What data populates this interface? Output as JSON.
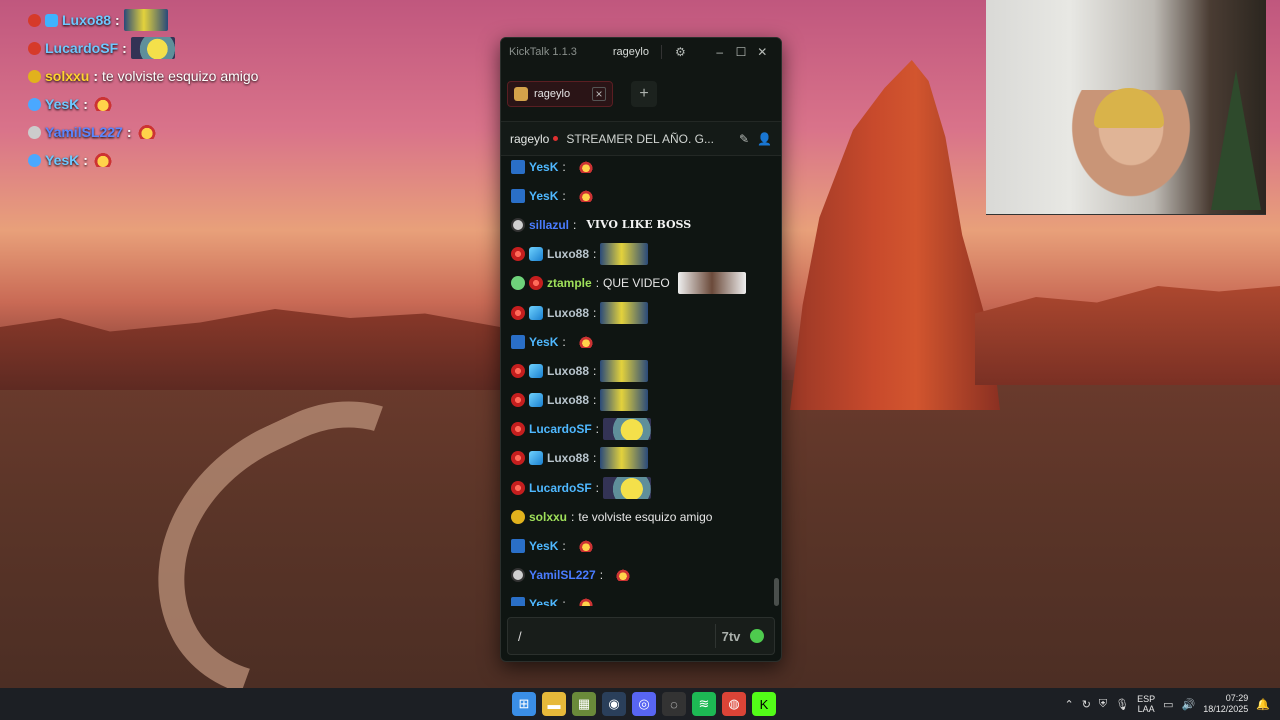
{
  "overlay_chat": [
    {
      "user": "Luxo88",
      "badge": "red",
      "badge2": "cube",
      "color": "cyan",
      "text": "",
      "emote": "wide"
    },
    {
      "user": "LucardoSF",
      "badge": "red",
      "color": "cyan",
      "text": "",
      "emote": "ball"
    },
    {
      "user": "solxxu",
      "badge": "gold",
      "color": "yellow",
      "text": "te volviste esquizo amigo",
      "emote": ""
    },
    {
      "user": "YesK",
      "badge": "pick",
      "color": "cyan",
      "text": "",
      "emote": "small"
    },
    {
      "user": "YamilSL227",
      "badge": "skull",
      "color": "blue",
      "text": "",
      "emote": "small"
    },
    {
      "user": "YesK",
      "badge": "pick",
      "color": "cyan",
      "text": "",
      "emote": "small"
    }
  ],
  "window": {
    "app_title": "KickTalk 1.1.3",
    "titlebar_user": "rageylo",
    "settings_icon": "gear-icon",
    "minimize_icon": "minimize-icon",
    "maximize_icon": "maximize-icon",
    "close_icon": "close-icon"
  },
  "tabs": [
    {
      "label": "rageylo",
      "active": true
    }
  ],
  "add_tab_label": "+",
  "channel": {
    "name": "rageylo",
    "stream_title": "STREAMER DEL AÑO. G...",
    "pin_icon": "pin-icon",
    "user_icon": "user-icon"
  },
  "chat_messages": [
    {
      "user": "YesK",
      "badges": [
        "pick"
      ],
      "color": "cyan",
      "text": "",
      "emote": "small"
    },
    {
      "user": "YesK",
      "badges": [
        "pick"
      ],
      "color": "cyan",
      "text": "",
      "emote": "small"
    },
    {
      "user": "sillazul",
      "badges": [
        "skull"
      ],
      "color": "blue",
      "text": "",
      "emote": "vivo",
      "emote_text": "VIVO LIKE BOSS"
    },
    {
      "user": "Luxo88",
      "badges": [
        "red",
        "cube"
      ],
      "color": "gray",
      "text": "",
      "emote": "wide"
    },
    {
      "user": "ztample",
      "badges": [
        "alien",
        "red"
      ],
      "color": "green",
      "text": "QUE VIDEO",
      "emote": "face"
    },
    {
      "user": "Luxo88",
      "badges": [
        "red",
        "cube"
      ],
      "color": "gray",
      "text": "",
      "emote": "wide"
    },
    {
      "user": "YesK",
      "badges": [
        "pick"
      ],
      "color": "cyan",
      "text": "",
      "emote": "small"
    },
    {
      "user": "Luxo88",
      "badges": [
        "red",
        "cube"
      ],
      "color": "gray",
      "text": "",
      "emote": "wide"
    },
    {
      "user": "Luxo88",
      "badges": [
        "red",
        "cube"
      ],
      "color": "gray",
      "text": "",
      "emote": "wide"
    },
    {
      "user": "LucardoSF",
      "badges": [
        "red"
      ],
      "color": "cyan",
      "text": "",
      "emote": "ball"
    },
    {
      "user": "Luxo88",
      "badges": [
        "red",
        "cube"
      ],
      "color": "gray",
      "text": "",
      "emote": "wide"
    },
    {
      "user": "LucardoSF",
      "badges": [
        "red"
      ],
      "color": "cyan",
      "text": "",
      "emote": "ball"
    },
    {
      "user": "solxxu",
      "badges": [
        "gold"
      ],
      "color": "green",
      "text": "te volviste esquizo amigo",
      "emote": ""
    },
    {
      "user": "YesK",
      "badges": [
        "pick"
      ],
      "color": "cyan",
      "text": "",
      "emote": "small"
    },
    {
      "user": "YamilSL227",
      "badges": [
        "skull"
      ],
      "color": "blue",
      "text": "",
      "emote": "small"
    },
    {
      "user": "YesK",
      "badges": [
        "pick"
      ],
      "color": "cyan",
      "text": "",
      "emote": "small"
    }
  ],
  "input": {
    "value": "/",
    "placeholder": "",
    "emote_button": "7tv",
    "emoji_icon": "emoji-icon"
  },
  "taskbar": {
    "apps": [
      "windows-start-icon",
      "file-explorer-icon",
      "app-icon",
      "steam-icon",
      "discord-icon",
      "obs-icon",
      "spotify-icon",
      "chrome-icon",
      "kick-icon"
    ],
    "lang_line1": "ESP",
    "lang_line2": "LAA",
    "time": "07:29",
    "date": "18/12/2025"
  },
  "colors": {
    "kick_green": "#53fc18",
    "live_red": "#e03030",
    "accent_tab": "#5a1e22"
  }
}
